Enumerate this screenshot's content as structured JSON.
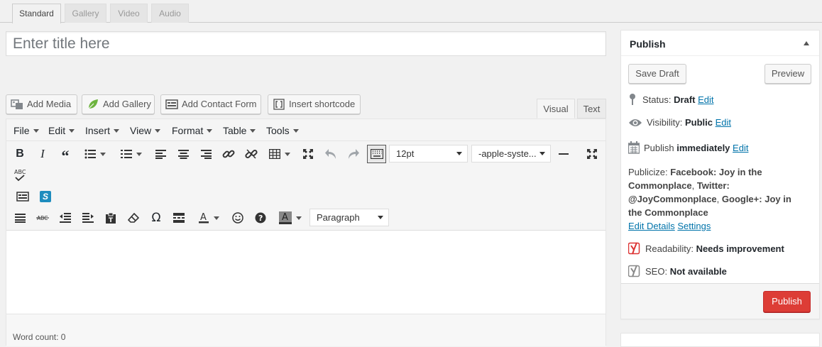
{
  "format_tabs": [
    {
      "label": "Standard",
      "active": true
    },
    {
      "label": "Gallery",
      "active": false
    },
    {
      "label": "Video",
      "active": false
    },
    {
      "label": "Audio",
      "active": false
    }
  ],
  "title": {
    "value": "",
    "placeholder": "Enter title here"
  },
  "media_buttons": {
    "add_media": "Add Media",
    "add_gallery": "Add Gallery",
    "add_contact_form": "Add Contact Form",
    "insert_shortcode": "Insert shortcode"
  },
  "editor_tabs": {
    "visual": "Visual",
    "text": "Text",
    "active": "Visual"
  },
  "menubar": [
    "File",
    "Edit",
    "Insert",
    "View",
    "Format",
    "Table",
    "Tools"
  ],
  "toolbar": {
    "font_size": "12pt",
    "font_family": "-apple-syste...",
    "block_format": "Paragraph"
  },
  "editor": {
    "content": "",
    "word_count": "Word count: 0"
  },
  "publish": {
    "title": "Publish",
    "save_draft": "Save Draft",
    "preview": "Preview",
    "status_label": "Status:",
    "status_value": "Draft",
    "visibility_label": "Visibility:",
    "visibility_value": "Public",
    "publish_label": "Publish",
    "publish_value": "immediately",
    "edit_link": "Edit",
    "publicize_label": "Publicize:",
    "publicize_facebook_label": "Facebook:",
    "publicize_facebook_value": "Joy in the Commonplace",
    "publicize_twitter_label": "Twitter:",
    "publicize_twitter_value": "@JoyCommonplace",
    "publicize_google_label": "Google+:",
    "publicize_google_value": "Joy in the Commonplace",
    "edit_details": "Edit Details",
    "settings": "Settings",
    "readability_label": "Readability:",
    "readability_value": "Needs improvement",
    "seo_label": "SEO:",
    "seo_value": "Not available",
    "publish_button": "Publish"
  },
  "colors": {
    "publish_button": "#dd3d36",
    "link": "#0073aa",
    "readability_icon": "#dc3232",
    "seo_icon": "#888888",
    "shortcode_icon_bg": "#1e8cbe"
  }
}
